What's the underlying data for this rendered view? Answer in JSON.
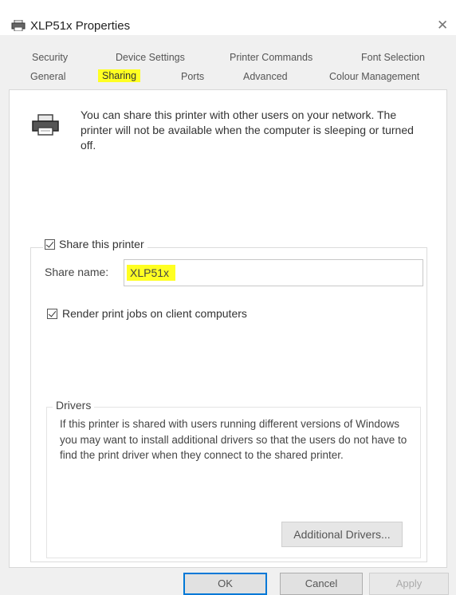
{
  "window": {
    "title": "XLP51x Properties",
    "close_symbol": "✕"
  },
  "tabs": {
    "row1": [
      "Security",
      "Device Settings",
      "Printer Commands",
      "Font Selection"
    ],
    "row2": [
      "General",
      "Sharing",
      "Ports",
      "Advanced",
      "Colour Management"
    ],
    "active": "Sharing"
  },
  "sharing": {
    "intro": "You can share this printer with other users on your network. The printer will not be available when the computer is sleeping or turned off.",
    "share_checkbox_label": "Share this printer",
    "share_checked": true,
    "share_name_label": "Share name:",
    "share_name_value": "XLP51x",
    "render_checkbox_label": "Render print jobs on client computers",
    "render_checked": true
  },
  "drivers": {
    "title": "Drivers",
    "text": "If this printer is shared with users running different versions of Windows you may want to install additional drivers so that the users do not have to find the print driver when they connect to the shared printer.",
    "button_label": "Additional Drivers..."
  },
  "buttons": {
    "ok": "OK",
    "cancel": "Cancel",
    "apply": "Apply"
  },
  "icons": [
    "printer-icon",
    "close-icon",
    "shared-printer-icon",
    "checkbox-checked-icon"
  ],
  "colors": {
    "highlight": "#ffff22",
    "ok_border": "#0078d7"
  }
}
